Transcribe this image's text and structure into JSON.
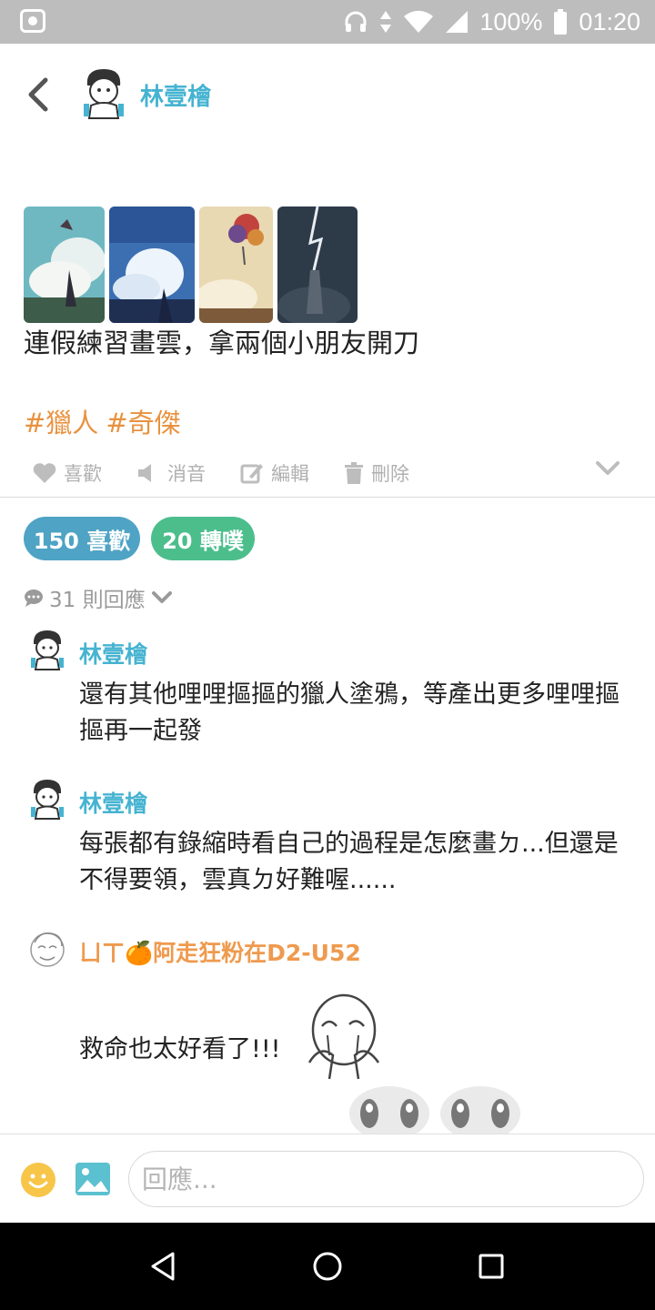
{
  "status_bar": {
    "battery": "100%",
    "time": "01:20",
    "icons": [
      "app-tv-icon",
      "headphones-icon",
      "data-arrows-icon",
      "wifi-icon",
      "signal-icon",
      "battery-icon"
    ]
  },
  "header": {
    "back_icon": "chevron-left-icon",
    "author_name": "林壹檜"
  },
  "post": {
    "thumbnails": [
      "thumbnail-1",
      "thumbnail-2",
      "thumbnail-3",
      "thumbnail-4"
    ],
    "text": "連假練習畫雲，拿兩個小朋友開刀",
    "tags": [
      "#獵人",
      "#奇傑"
    ]
  },
  "actions": {
    "like": "喜歡",
    "mute": "消音",
    "edit": "編輯",
    "delete": "刪除",
    "expand_icon": "chevron-down-icon"
  },
  "stats": {
    "likes": "150 喜歡",
    "replurks": "20 轉噗",
    "reply_count": "31 則回應"
  },
  "comments": [
    {
      "name": "林壹檜",
      "text": "還有其他哩哩摳摳的獵人塗鴉，等產出更多哩哩摳摳再一起發"
    },
    {
      "name": "林壹檜",
      "text": "每張都有錄縮時看自己的過程是怎麼畫ㄉ...但還是不得要領，雲真ㄉ好難喔......"
    },
    {
      "name": "ㄩㄒ🍊阿走狂粉在D2-U52",
      "text": "救命也太好看了!!!"
    }
  ],
  "reply_bar": {
    "placeholder": "回應...",
    "emoji_icon": "smiley-icon",
    "image_icon": "image-icon"
  },
  "colors": {
    "accent_blue": "#45b3d1",
    "tag_orange": "#e8923f",
    "likes_pill": "#4fa3c4",
    "replurks_pill": "#4cbe8c",
    "status_bar": "#bdbdbd"
  }
}
